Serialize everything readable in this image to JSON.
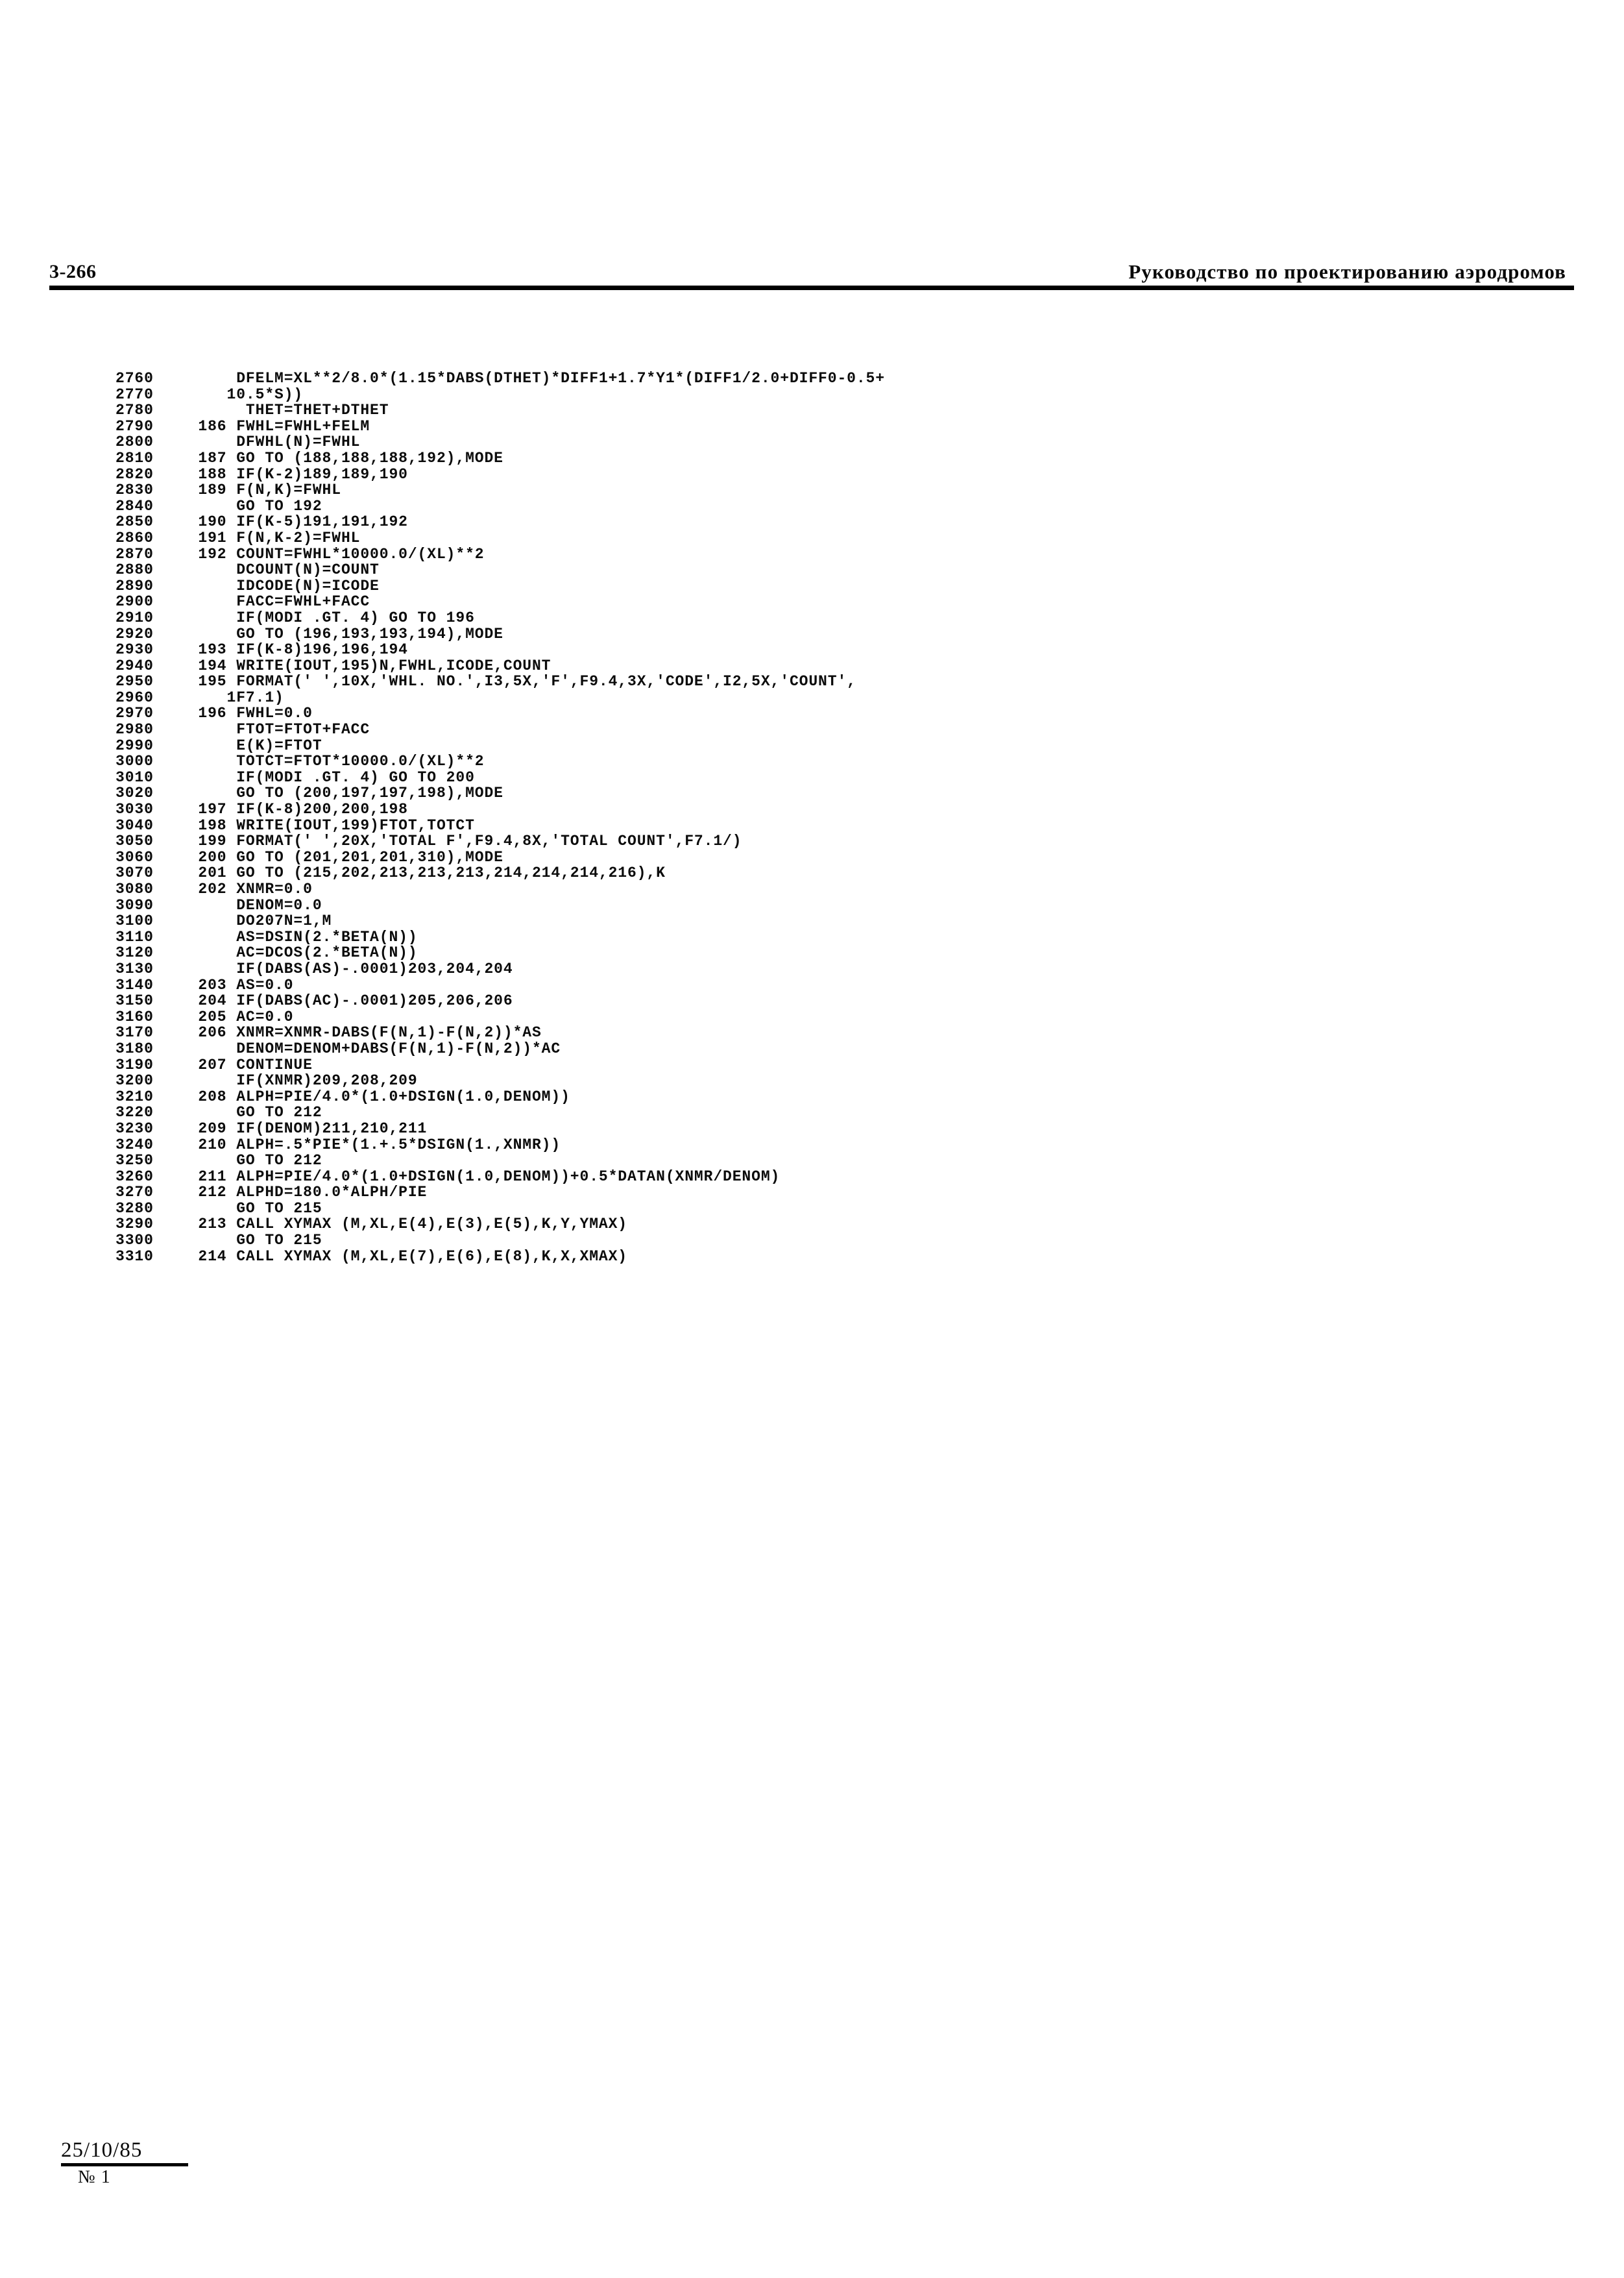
{
  "header": {
    "folio": "3-266",
    "title": "Руководство по проектированию аэродромов"
  },
  "footer": {
    "date": "25/10/85",
    "number": "№ 1"
  },
  "listing": {
    "lines": [
      {
        "seq": "2760",
        "code": "      DFELM=XL**2/8.0*(1.15*DABS(DTHET)*DIFF1+1.7*Y1*(DIFF1/2.0+DIFF0-0.5+"
      },
      {
        "seq": "2770",
        "code": "     10.5*S))"
      },
      {
        "seq": "2780",
        "code": "       THET=THET+DTHET"
      },
      {
        "seq": "2790",
        "code": "  186 FWHL=FWHL+FELM"
      },
      {
        "seq": "2800",
        "code": "      DFWHL(N)=FWHL"
      },
      {
        "seq": "2810",
        "code": "  187 GO TO (188,188,188,192),MODE"
      },
      {
        "seq": "2820",
        "code": "  188 IF(K-2)189,189,190"
      },
      {
        "seq": "2830",
        "code": "  189 F(N,K)=FWHL"
      },
      {
        "seq": "2840",
        "code": "      GO TO 192"
      },
      {
        "seq": "2850",
        "code": "  190 IF(K-5)191,191,192"
      },
      {
        "seq": "2860",
        "code": "  191 F(N,K-2)=FWHL"
      },
      {
        "seq": "2870",
        "code": "  192 COUNT=FWHL*10000.0/(XL)**2"
      },
      {
        "seq": "2880",
        "code": "      DCOUNT(N)=COUNT"
      },
      {
        "seq": "2890",
        "code": "      IDCODE(N)=ICODE"
      },
      {
        "seq": "2900",
        "code": "      FACC=FWHL+FACC"
      },
      {
        "seq": "2910",
        "code": "      IF(MODI .GT. 4) GO TO 196"
      },
      {
        "seq": "2920",
        "code": "      GO TO (196,193,193,194),MODE"
      },
      {
        "seq": "2930",
        "code": "  193 IF(K-8)196,196,194"
      },
      {
        "seq": "2940",
        "code": "  194 WRITE(IOUT,195)N,FWHL,ICODE,COUNT"
      },
      {
        "seq": "2950",
        "code": "  195 FORMAT(' ',10X,'WHL. NO.',I3,5X,'F',F9.4,3X,'CODE',I2,5X,'COUNT',"
      },
      {
        "seq": "2960",
        "code": "     1F7.1)"
      },
      {
        "seq": "2970",
        "code": "  196 FWHL=0.0"
      },
      {
        "seq": "2980",
        "code": "      FTOT=FTOT+FACC"
      },
      {
        "seq": "2990",
        "code": "      E(K)=FTOT"
      },
      {
        "seq": "3000",
        "code": "      TOTCT=FTOT*10000.0/(XL)**2"
      },
      {
        "seq": "3010",
        "code": "      IF(MODI .GT. 4) GO TO 200"
      },
      {
        "seq": "3020",
        "code": "      GO TO (200,197,197,198),MODE"
      },
      {
        "seq": "3030",
        "code": "  197 IF(K-8)200,200,198"
      },
      {
        "seq": "3040",
        "code": "  198 WRITE(IOUT,199)FTOT,TOTCT"
      },
      {
        "seq": "3050",
        "code": "  199 FORMAT(' ',20X,'TOTAL F',F9.4,8X,'TOTAL COUNT',F7.1/)"
      },
      {
        "seq": "3060",
        "code": "  200 GO TO (201,201,201,310),MODE"
      },
      {
        "seq": "3070",
        "code": "  201 GO TO (215,202,213,213,213,214,214,214,216),K"
      },
      {
        "seq": "3080",
        "code": "  202 XNMR=0.0"
      },
      {
        "seq": "3090",
        "code": "      DENOM=0.0"
      },
      {
        "seq": "3100",
        "code": "      DO207N=1,M"
      },
      {
        "seq": "3110",
        "code": "      AS=DSIN(2.*BETA(N))"
      },
      {
        "seq": "3120",
        "code": "      AC=DCOS(2.*BETA(N))"
      },
      {
        "seq": "3130",
        "code": "      IF(DABS(AS)-.0001)203,204,204"
      },
      {
        "seq": "3140",
        "code": "  203 AS=0.0"
      },
      {
        "seq": "3150",
        "code": "  204 IF(DABS(AC)-.0001)205,206,206"
      },
      {
        "seq": "3160",
        "code": "  205 AC=0.0"
      },
      {
        "seq": "3170",
        "code": "  206 XNMR=XNMR-DABS(F(N,1)-F(N,2))*AS"
      },
      {
        "seq": "3180",
        "code": "      DENOM=DENOM+DABS(F(N,1)-F(N,2))*AC"
      },
      {
        "seq": "3190",
        "code": "  207 CONTINUE"
      },
      {
        "seq": "3200",
        "code": "      IF(XNMR)209,208,209"
      },
      {
        "seq": "3210",
        "code": "  208 ALPH=PIE/4.0*(1.0+DSIGN(1.0,DENOM))"
      },
      {
        "seq": "3220",
        "code": "      GO TO 212"
      },
      {
        "seq": "3230",
        "code": "  209 IF(DENOM)211,210,211"
      },
      {
        "seq": "3240",
        "code": "  210 ALPH=.5*PIE*(1.+.5*DSIGN(1.,XNMR))"
      },
      {
        "seq": "3250",
        "code": "      GO TO 212"
      },
      {
        "seq": "3260",
        "code": "  211 ALPH=PIE/4.0*(1.0+DSIGN(1.0,DENOM))+0.5*DATAN(XNMR/DENOM)"
      },
      {
        "seq": "3270",
        "code": "  212 ALPHD=180.0*ALPH/PIE"
      },
      {
        "seq": "3280",
        "code": "      GO TO 215"
      },
      {
        "seq": "3290",
        "code": "  213 CALL XYMAX (M,XL,E(4),E(3),E(5),K,Y,YMAX)"
      },
      {
        "seq": "3300",
        "code": "      GO TO 215"
      },
      {
        "seq": "3310",
        "code": "  214 CALL XYMAX (M,XL,E(7),E(6),E(8),K,X,XMAX)"
      }
    ]
  }
}
